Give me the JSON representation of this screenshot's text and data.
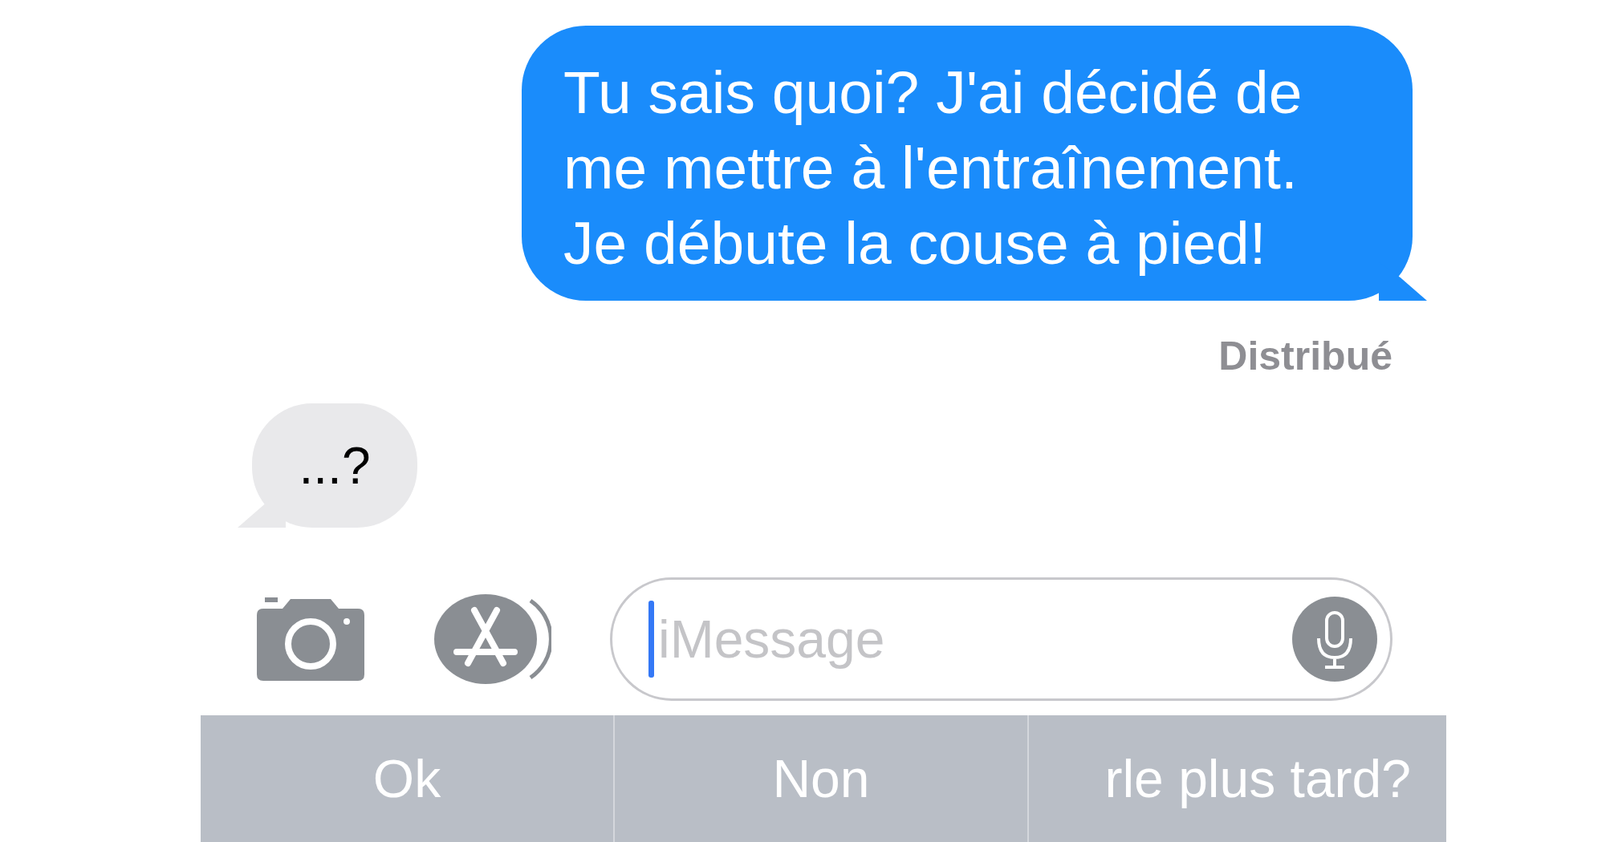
{
  "messages": [
    {
      "kind": "sent",
      "text": "Tu sais quoi? J'ai décidé de\nme mettre à l'entraînement.\nJe débute la couse à pied!",
      "status": "Distribué"
    },
    {
      "kind": "received",
      "text": "...?"
    }
  ],
  "compose": {
    "placeholder": "iMessage"
  },
  "suggestions": [
    "Ok",
    "Non",
    "rle plus tard?"
  ]
}
